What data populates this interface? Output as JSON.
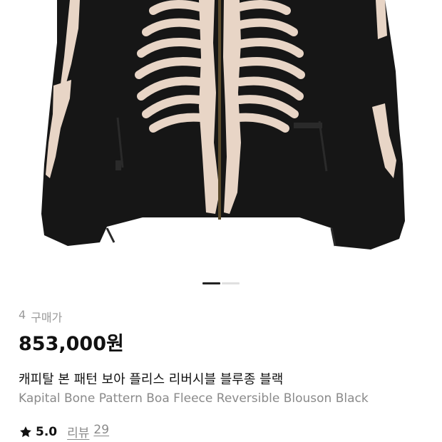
{
  "product": {
    "image_name": "skeleton-bone-fleece-jacket",
    "carousel": {
      "total": 2,
      "active": 0
    },
    "purchase_count": "4",
    "purchase_label": "구매가",
    "price": "853,000원",
    "title_kr": "캐피탈 본 패턴 보아 플리스 리버시블 블루종 블랙",
    "title_en": "Kapital Bone Pattern Boa Fleece Reversible Blouson Black",
    "rating": "5.0",
    "review_label": "리뷰",
    "review_count": "29"
  },
  "colors": {
    "text": "#111111",
    "muted": "#8a8a8a",
    "indicator_active": "#222222",
    "indicator_inactive": "#e0e0e0"
  }
}
